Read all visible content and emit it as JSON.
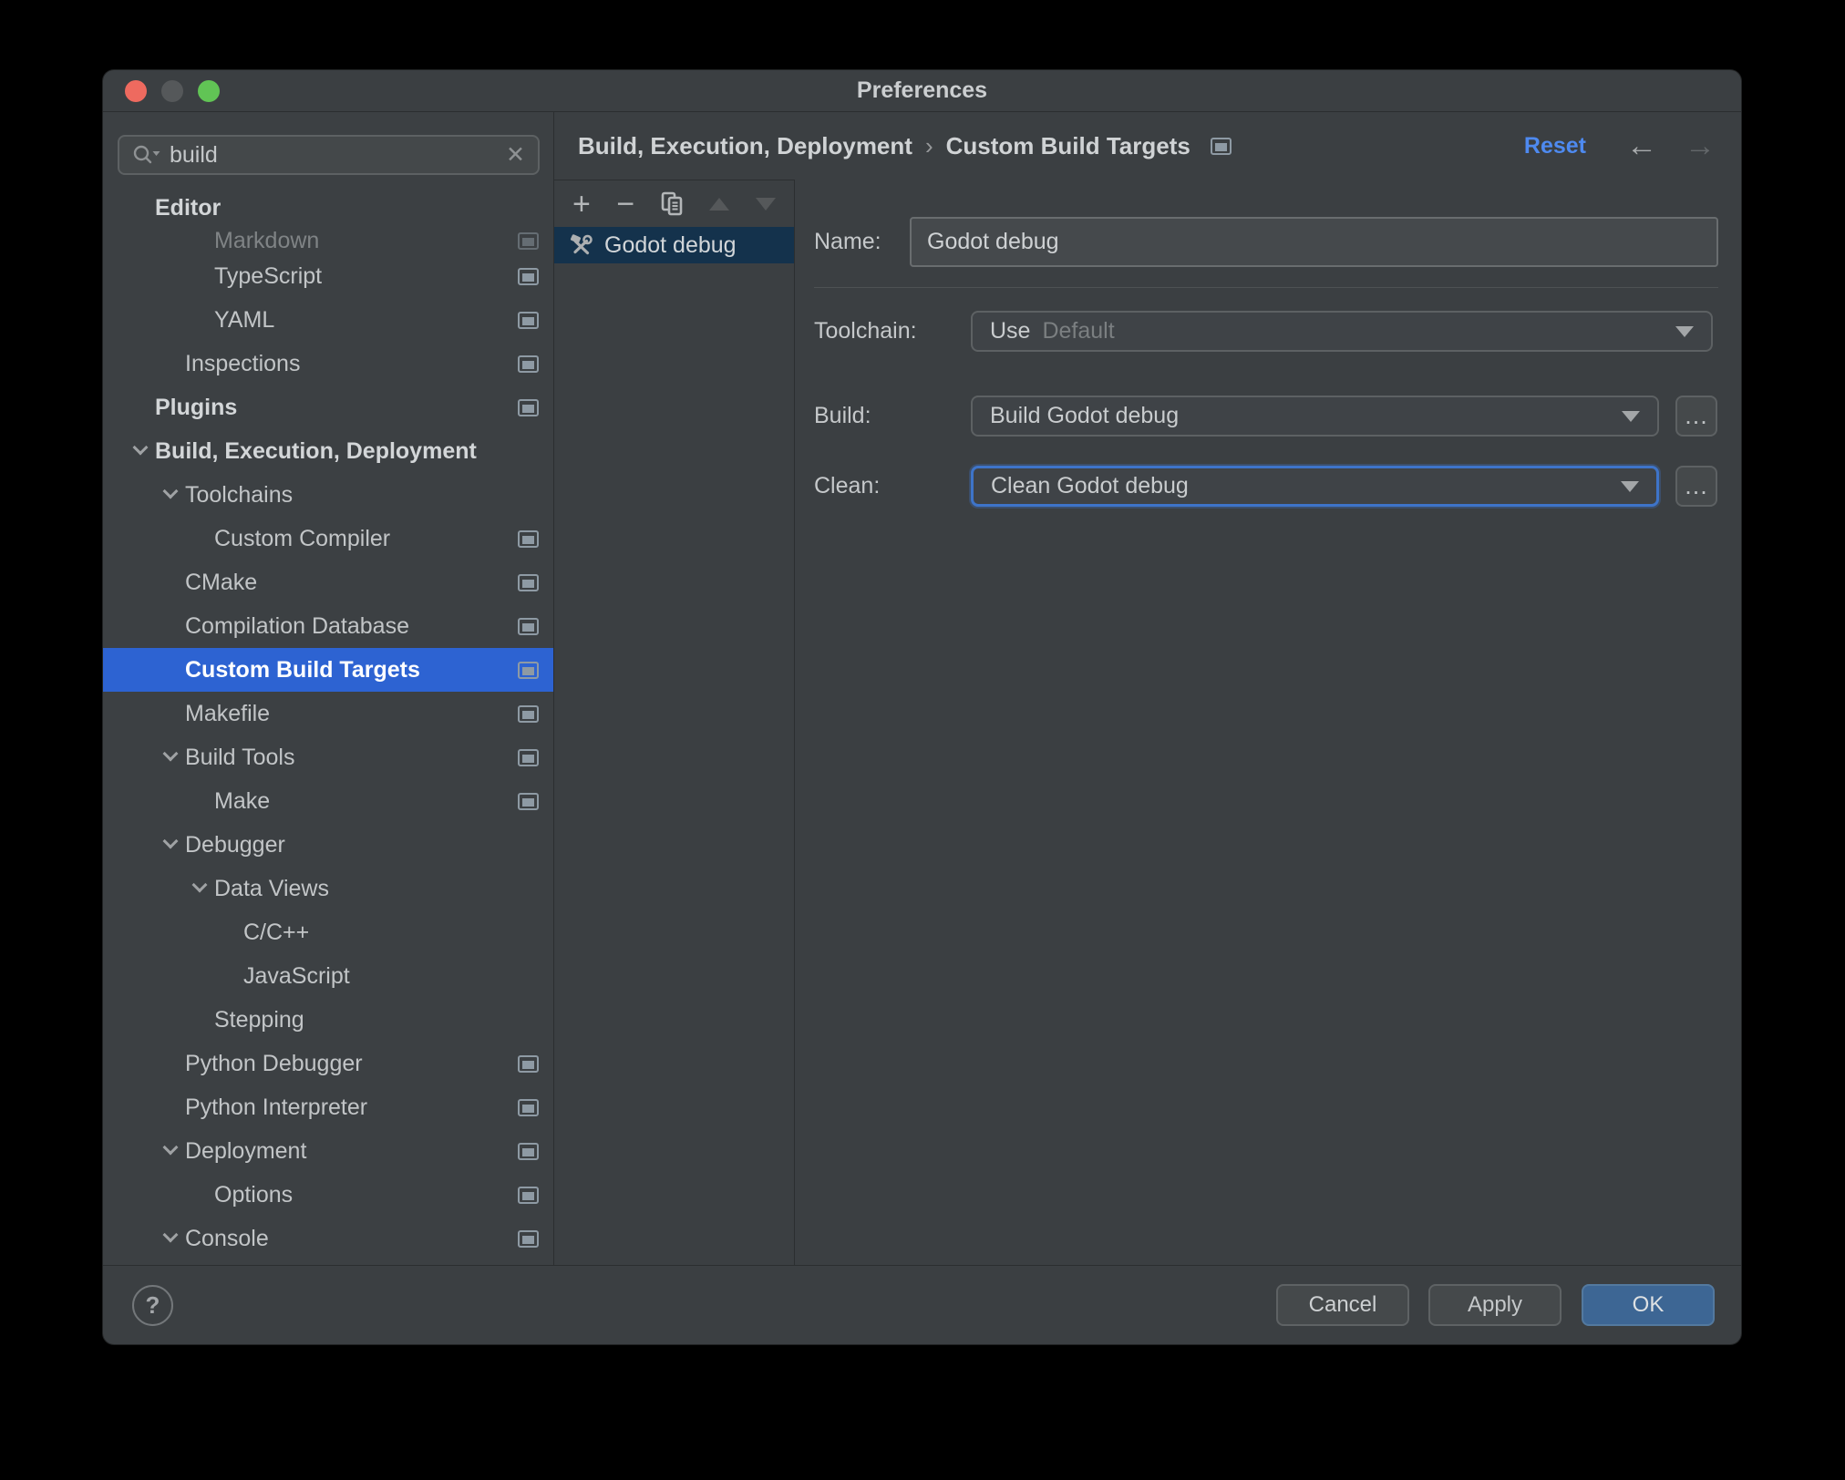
{
  "window": {
    "title": "Preferences"
  },
  "sidebar": {
    "search": {
      "value": "build",
      "clear_glyph": "✕"
    },
    "tree": [
      {
        "label": "Editor",
        "level": 0,
        "bold": true
      },
      {
        "label": "Markdown",
        "level": 2,
        "icon": true,
        "clipped": true
      },
      {
        "label": "TypeScript",
        "level": 2,
        "icon": true
      },
      {
        "label": "YAML",
        "level": 2,
        "icon": true
      },
      {
        "label": "Inspections",
        "level": 1,
        "icon": true
      },
      {
        "label": "Plugins",
        "level": 0,
        "bold": true,
        "icon": true
      },
      {
        "label": "Build, Execution, Deployment",
        "level": 0,
        "bold": true,
        "chevron": true
      },
      {
        "label": "Toolchains",
        "level": 1,
        "chevron": true
      },
      {
        "label": "Custom Compiler",
        "level": 2,
        "icon": true
      },
      {
        "label": "CMake",
        "level": 1,
        "icon": true
      },
      {
        "label": "Compilation Database",
        "level": 1,
        "icon": true
      },
      {
        "label": "Custom Build Targets",
        "level": 1,
        "icon": true,
        "selected": true
      },
      {
        "label": "Makefile",
        "level": 1,
        "icon": true
      },
      {
        "label": "Build Tools",
        "level": 1,
        "chevron": true,
        "icon": true
      },
      {
        "label": "Make",
        "level": 2,
        "icon": true
      },
      {
        "label": "Debugger",
        "level": 1,
        "chevron": true
      },
      {
        "label": "Data Views",
        "level": 2,
        "chevron": true
      },
      {
        "label": "C/C++",
        "level": 3
      },
      {
        "label": "JavaScript",
        "level": 3
      },
      {
        "label": "Stepping",
        "level": 2
      },
      {
        "label": "Python Debugger",
        "level": 1,
        "icon": true
      },
      {
        "label": "Python Interpreter",
        "level": 1,
        "icon": true
      },
      {
        "label": "Deployment",
        "level": 1,
        "chevron": true,
        "icon": true
      },
      {
        "label": "Options",
        "level": 2,
        "icon": true
      },
      {
        "label": "Console",
        "level": 1,
        "chevron": true,
        "icon": true
      }
    ]
  },
  "header": {
    "breadcrumb": {
      "section": "Build, Execution, Deployment",
      "page": "Custom Build Targets"
    },
    "separator": "›",
    "reset_label": "Reset",
    "back_glyph": "←",
    "forward_glyph": "→"
  },
  "targets": {
    "items": [
      {
        "label": "Godot debug"
      }
    ]
  },
  "form": {
    "name_label": "Name:",
    "name_value": "Godot debug",
    "toolchain_label": "Toolchain:",
    "toolchain_prefix": "Use",
    "toolchain_value": "Default",
    "build_label": "Build:",
    "build_value": "Build Godot debug",
    "clean_label": "Clean:",
    "clean_value": "Clean Godot debug",
    "browse_glyph": "..."
  },
  "footer": {
    "help_label": "?",
    "cancel_label": "Cancel",
    "apply_label": "Apply",
    "ok_label": "OK"
  },
  "colors": {
    "tree_selection_blue": "#2D63D2",
    "list_selection_navy": "#14324C",
    "accent_link_blue": "#4E8AF0",
    "ok_button_blue": "#3D6694",
    "focus_ring_blue": "#3E74C9",
    "window_background": "#3B3F42"
  }
}
